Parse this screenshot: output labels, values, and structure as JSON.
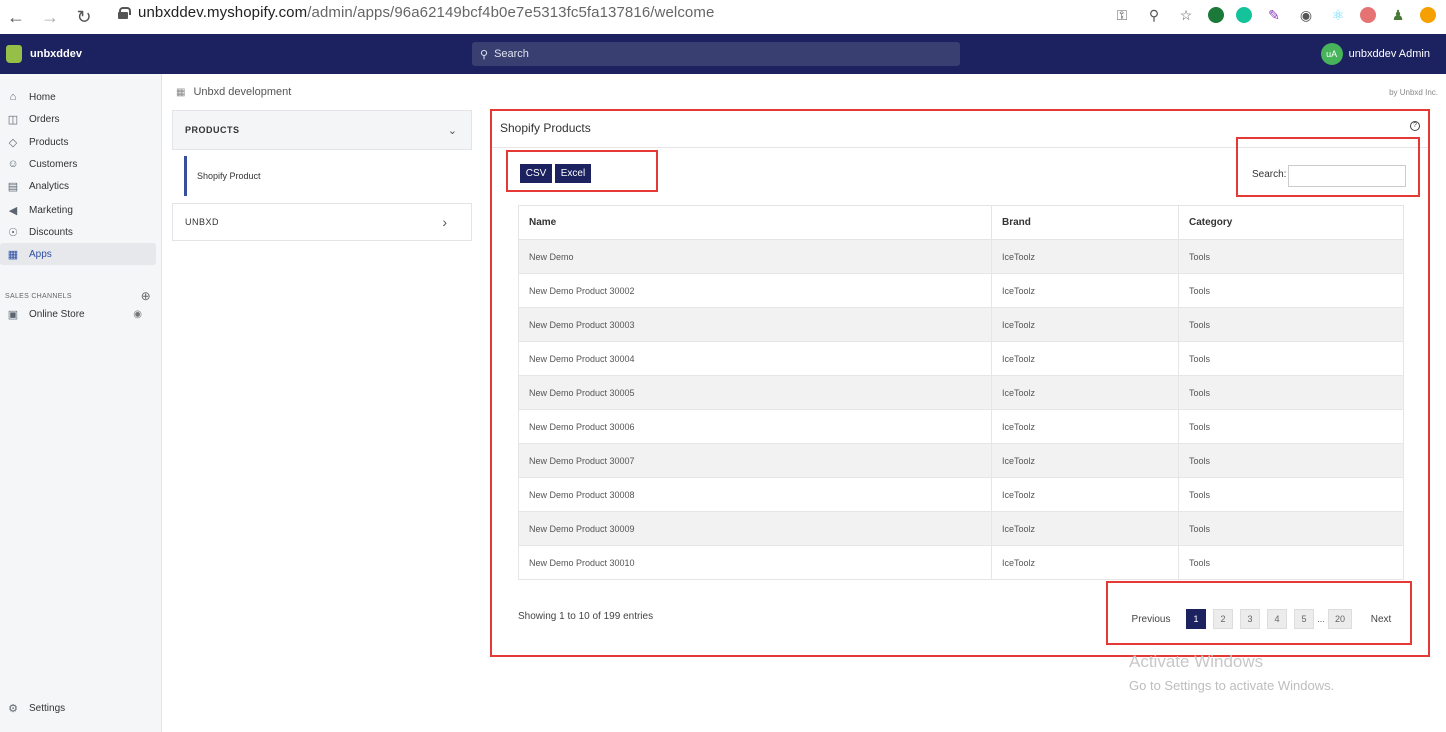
{
  "browser": {
    "url_host": "unbxddev.myshopify.com",
    "url_path": "/admin/apps/96a62149bcf4b0e7e5313fc5fa137816/welcome"
  },
  "topbar": {
    "store_name": "unbxddev",
    "search_placeholder": "Search",
    "avatar_initials": "uA",
    "admin_name": "unbxddev Admin"
  },
  "sidenav": {
    "items": [
      {
        "label": "Home",
        "icon": "home-icon"
      },
      {
        "label": "Orders",
        "icon": "orders-icon"
      },
      {
        "label": "Products",
        "icon": "tag-icon"
      },
      {
        "label": "Customers",
        "icon": "person-icon"
      },
      {
        "label": "Analytics",
        "icon": "bar-chart-icon"
      },
      {
        "label": "Marketing",
        "icon": "megaphone-icon"
      },
      {
        "label": "Discounts",
        "icon": "discount-icon"
      },
      {
        "label": "Apps",
        "icon": "apps-icon"
      }
    ],
    "channels_header": "SALES CHANNELS",
    "online_store": "Online Store",
    "settings": "Settings"
  },
  "app": {
    "name": "Unbxd development",
    "byline": "by Unbxd Inc."
  },
  "inner_nav": {
    "products": "PRODUCTS",
    "shopify_product": "Shopify Product",
    "unbxd": "UNBXD"
  },
  "panel": {
    "title": "Shopify Products",
    "csv_label": "CSV",
    "excel_label": "Excel",
    "search_label": "Search:",
    "columns": [
      "Name",
      "Brand",
      "Category"
    ],
    "rows": [
      [
        "New Demo",
        "IceToolz",
        "Tools"
      ],
      [
        "New Demo Product 30002",
        "IceToolz",
        "Tools"
      ],
      [
        "New Demo Product 30003",
        "IceToolz",
        "Tools"
      ],
      [
        "New Demo Product 30004",
        "IceToolz",
        "Tools"
      ],
      [
        "New Demo Product 30005",
        "IceToolz",
        "Tools"
      ],
      [
        "New Demo Product 30006",
        "IceToolz",
        "Tools"
      ],
      [
        "New Demo Product 30007",
        "IceToolz",
        "Tools"
      ],
      [
        "New Demo Product 30008",
        "IceToolz",
        "Tools"
      ],
      [
        "New Demo Product 30009",
        "IceToolz",
        "Tools"
      ],
      [
        "New Demo Product 30010",
        "IceToolz",
        "Tools"
      ]
    ],
    "info": "Showing 1 to 10 of 199 entries",
    "pager": {
      "previous": "Previous",
      "pages": [
        "1",
        "2",
        "3",
        "4",
        "5"
      ],
      "dots": "...",
      "last": "20",
      "next": "Next"
    }
  },
  "watermark": {
    "line1": "Activate Windows",
    "line2": "Go to Settings to activate Windows."
  },
  "colors": {
    "topbar": "#1c2260",
    "highlight": "#e53935",
    "button": "#1c2260"
  }
}
